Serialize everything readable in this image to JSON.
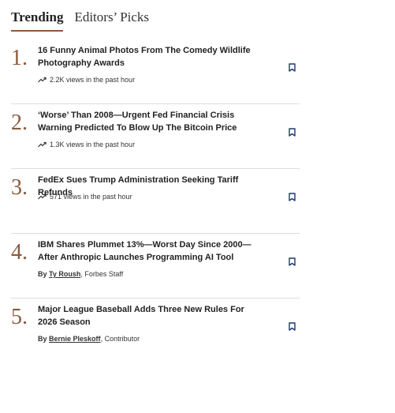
{
  "tabs": [
    {
      "label": "Trending",
      "active": true
    },
    {
      "label": "Editors’ Picks",
      "active": false
    }
  ],
  "accent_color": "#8a5a3c",
  "articles": [
    {
      "rank": "1.",
      "title": "16 Funny Animal Photos From The Comedy Wildlife Photography Awards",
      "meta": "2.2K views in the past hour",
      "meta_type": "trend"
    },
    {
      "rank": "2.",
      "title": "‘Worse’ Than 2008—Urgent Fed Financial Crisis Warning Predicted To Blow Up The Bitcoin Price",
      "meta": "1.3K views in the past hour",
      "meta_type": "trend"
    },
    {
      "rank": "3.",
      "title": "FedEx Sues Trump Administration Seeking Tariff Refunds",
      "meta": "571 views in the past hour",
      "meta_type": "trend"
    },
    {
      "rank": "4.",
      "title": "IBM Shares Plummet 13%—Worst Day Since 2000—After Anthropic Launches Programming AI Tool",
      "by": "By",
      "author": "Ty Roush",
      "role": ", Forbes Staff",
      "meta_type": "byline"
    },
    {
      "rank": "5.",
      "title": "Major League Baseball Adds Three New Rules For 2026 Season",
      "by": "By",
      "author": "Bernie Pleskoff",
      "role": ", Contributor",
      "meta_type": "byline"
    }
  ],
  "icons": {
    "trend": "trending-up-icon",
    "bookmark": "bookmark-icon"
  }
}
